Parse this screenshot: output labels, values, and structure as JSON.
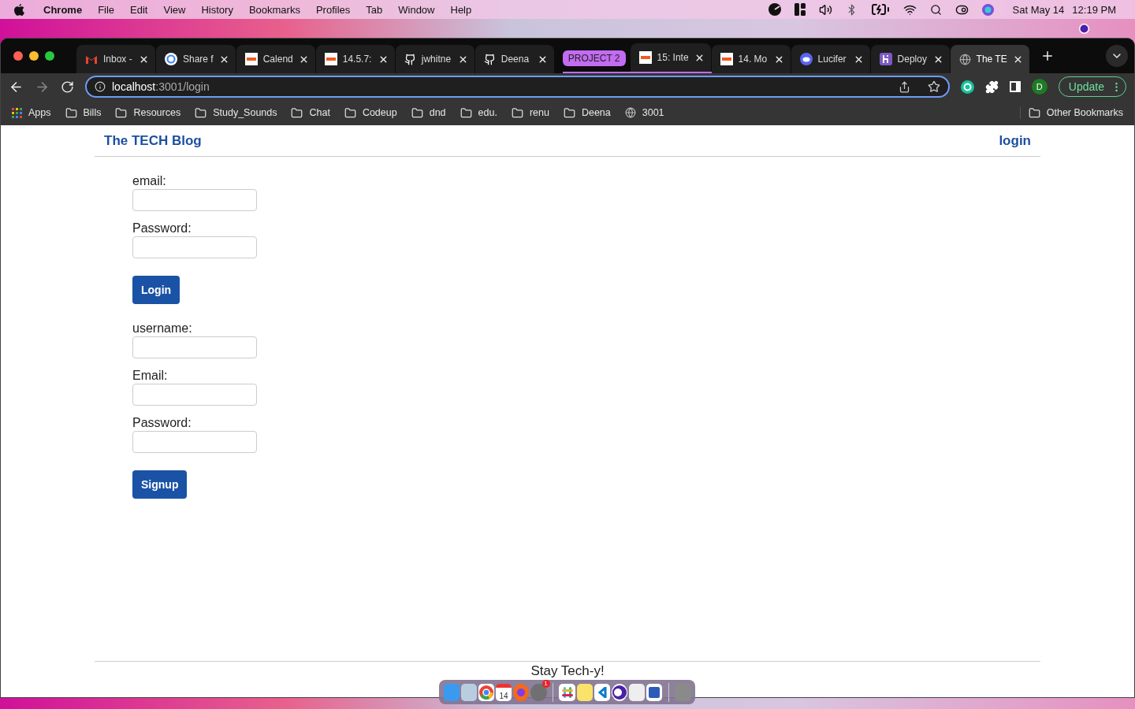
{
  "menu_bar": {
    "app": "Chrome",
    "menus": [
      "File",
      "Edit",
      "View",
      "History",
      "Bookmarks",
      "Profiles",
      "Tab",
      "Window",
      "Help"
    ],
    "date": "Sat May 14",
    "time": "12:19 PM"
  },
  "tab_strip": {
    "items": [
      {
        "kind": "tab",
        "title": "Inbox -",
        "selected": false
      },
      {
        "kind": "tab",
        "title": "Share f",
        "selected": false
      },
      {
        "kind": "tab",
        "title": "Calend",
        "selected": false
      },
      {
        "kind": "tab",
        "title": "14.5.7:",
        "selected": false
      },
      {
        "kind": "tab",
        "title": "jwhitne",
        "selected": false
      },
      {
        "kind": "tab",
        "title": "Deena",
        "selected": false
      },
      {
        "kind": "group",
        "label": "PROJECT 2",
        "tabs": [
          {
            "title": "15: Inte",
            "selected": false
          }
        ]
      },
      {
        "kind": "tab",
        "title": "14. Mo",
        "selected": false
      },
      {
        "kind": "tab",
        "title": "Lucifer",
        "selected": false
      },
      {
        "kind": "tab",
        "title": "Deploy",
        "selected": false
      },
      {
        "kind": "tab",
        "title": "The TE",
        "selected": true
      }
    ]
  },
  "toolbar": {
    "host": "localhost",
    "path": ":3001/login",
    "avatar": "D",
    "update": "Update"
  },
  "bookmarks": [
    {
      "kind": "apps",
      "label": "Apps"
    },
    {
      "kind": "folder",
      "label": "Bills"
    },
    {
      "kind": "folder",
      "label": "Resources"
    },
    {
      "kind": "folder",
      "label": "Study_Sounds"
    },
    {
      "kind": "folder",
      "label": "Chat"
    },
    {
      "kind": "folder",
      "label": "Codeup"
    },
    {
      "kind": "folder",
      "label": "dnd"
    },
    {
      "kind": "folder",
      "label": "edu."
    },
    {
      "kind": "folder",
      "label": "renu"
    },
    {
      "kind": "folder",
      "label": "Deena"
    },
    {
      "kind": "globe",
      "label": "3001"
    }
  ],
  "other_bookmarks": "Other Bookmarks",
  "page": {
    "brand": "The TECH Blog",
    "nav": "login",
    "forms": [
      {
        "fields": [
          {
            "label": "email:"
          },
          {
            "label": "Password:"
          }
        ],
        "button": "Login"
      },
      {
        "fields": [
          {
            "label": "username:"
          },
          {
            "label": "Email:"
          },
          {
            "label": "Password:"
          }
        ],
        "button": "Signup"
      }
    ],
    "footer": "Stay Tech-y!"
  },
  "dock": {
    "calendar_day": "14",
    "badge": "1"
  }
}
